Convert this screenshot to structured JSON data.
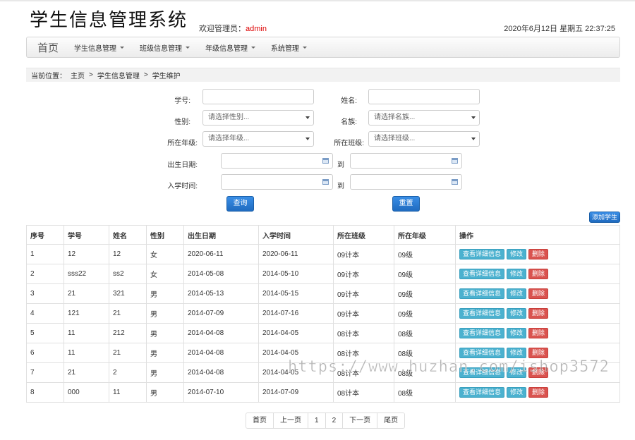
{
  "app": {
    "title": "学生信息管理系统",
    "welcome_prefix": "欢迎管理员：",
    "username": "admin",
    "datetime": "2020年6月12日 星期五 22:37:25"
  },
  "nav": {
    "home": "首页",
    "items": [
      {
        "label": "学生信息管理"
      },
      {
        "label": "班级信息管理"
      },
      {
        "label": "年级信息管理"
      },
      {
        "label": "系统管理"
      }
    ]
  },
  "breadcrumb": {
    "prefix": "当前位置：",
    "items": [
      "主页",
      ">",
      "学生信息管理",
      ">",
      "学生维护"
    ]
  },
  "form": {
    "student_no_label": "学号:",
    "name_label": "姓名:",
    "gender_label": "性别:",
    "gender_placeholder": "请选择性别...",
    "ethnicity_label": "名族:",
    "ethnicity_placeholder": "请选择名族...",
    "grade_label": "所在年级:",
    "grade_placeholder": "请选择年级...",
    "class_label": "所在班级:",
    "class_placeholder": "请选择班级...",
    "birth_label": "出生日期:",
    "enroll_label": "入学时间:",
    "to_label": "到",
    "query_button": "查询",
    "reset_button": "重置"
  },
  "add_button": "添加学生",
  "table": {
    "headers": [
      "序号",
      "学号",
      "姓名",
      "性别",
      "出生日期",
      "入学时间",
      "所在班级",
      "所在年级",
      "操作"
    ],
    "actions": {
      "view": "查看详细信息",
      "edit": "修改",
      "delete": "删除"
    },
    "rows": [
      [
        "1",
        "12",
        "12",
        "女",
        "2020-06-11",
        "2020-06-11",
        "09计本",
        "09级"
      ],
      [
        "2",
        "sss22",
        "ss2",
        "女",
        "2014-05-08",
        "2014-05-10",
        "09计本",
        "09级"
      ],
      [
        "3",
        "21",
        "321",
        "男",
        "2014-05-13",
        "2014-05-15",
        "09计本",
        "09级"
      ],
      [
        "4",
        "121",
        "21",
        "男",
        "2014-07-09",
        "2014-07-16",
        "09计本",
        "09级"
      ],
      [
        "5",
        "11",
        "212",
        "男",
        "2014-04-08",
        "2014-04-05",
        "08计本",
        "08级"
      ],
      [
        "6",
        "11",
        "21",
        "男",
        "2014-04-08",
        "2014-04-05",
        "08计本",
        "08级"
      ],
      [
        "7",
        "21",
        "2",
        "男",
        "2014-04-08",
        "2014-04-05",
        "08计本",
        "08级"
      ],
      [
        "8",
        "000",
        "11",
        "男",
        "2014-07-10",
        "2014-07-09",
        "08计本",
        "08级"
      ]
    ]
  },
  "pager": [
    "首页",
    "上一页",
    "1",
    "2",
    "下一页",
    "尾页"
  ],
  "watermark": "https://www.huzhan.com/ishop3572"
}
